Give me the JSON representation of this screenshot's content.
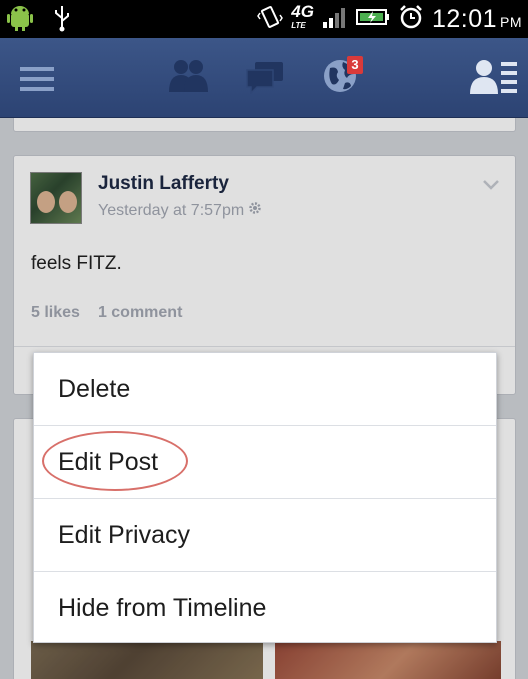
{
  "status_bar": {
    "network": "4G",
    "network_sub": "LTE",
    "time": "12:01",
    "ampm": "PM"
  },
  "nav": {
    "notifications_badge": "3"
  },
  "post": {
    "author": "Justin Lafferty",
    "timestamp": "Yesterday at 7:57pm",
    "text": "feels FITZ.",
    "likes": "5 likes",
    "comments": "1 comment"
  },
  "menu": {
    "items": [
      {
        "label": "Delete"
      },
      {
        "label": "Edit Post"
      },
      {
        "label": "Edit Privacy"
      },
      {
        "label": "Hide from Timeline"
      }
    ]
  },
  "colors": {
    "header_blue": "#3b5998",
    "badge_red": "#d93a3a",
    "highlight_circle": "#d8706a"
  }
}
